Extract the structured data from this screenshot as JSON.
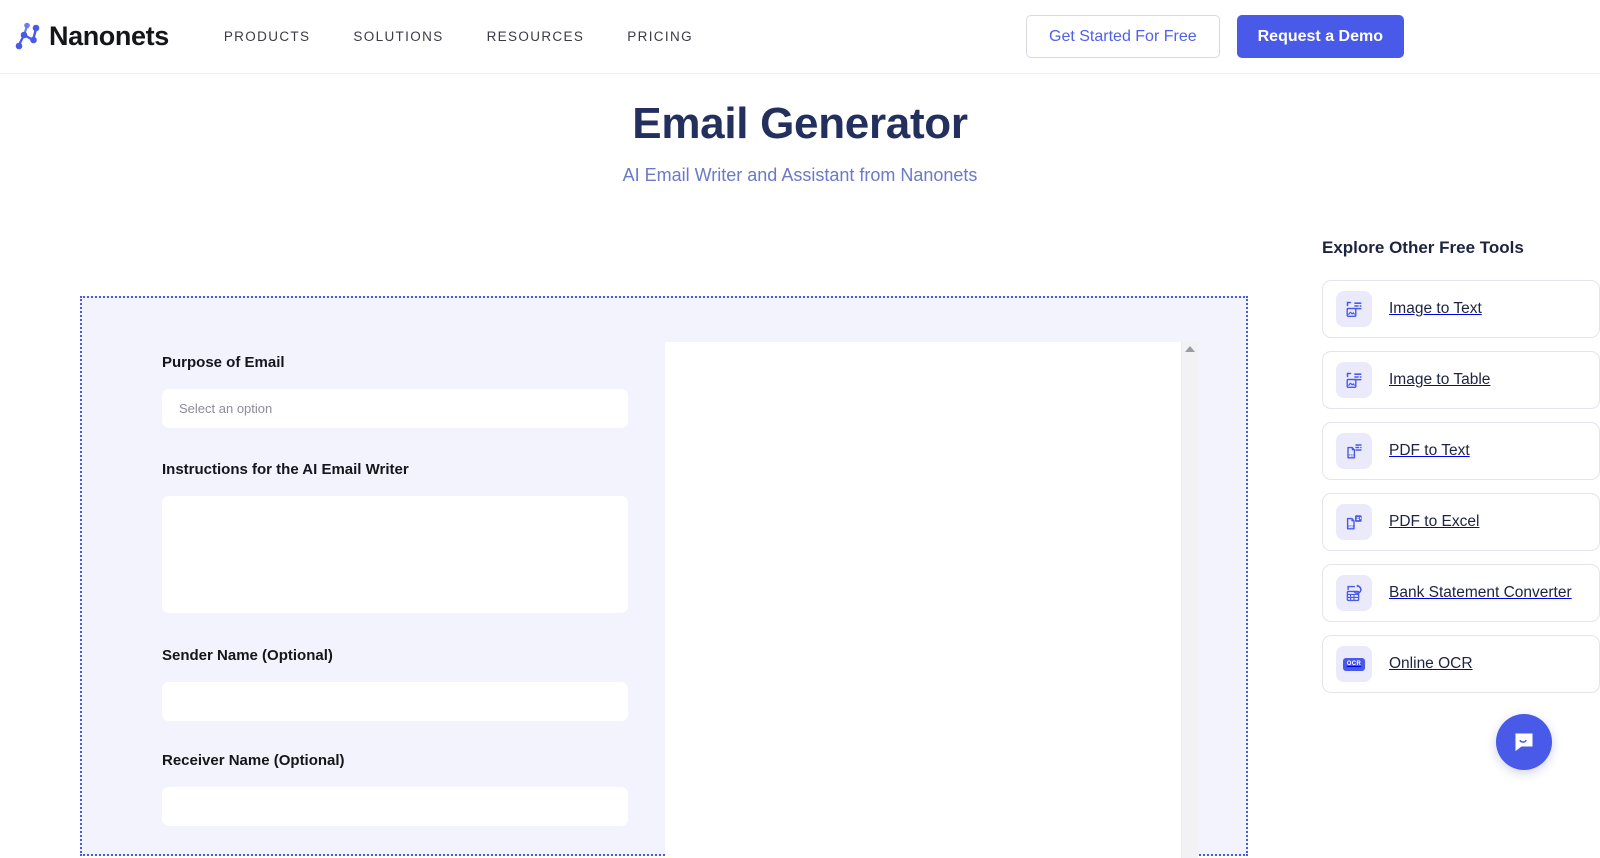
{
  "header": {
    "brand_name": "Nanonets",
    "logo_icon": "nanonets-network-logo",
    "nav": [
      {
        "label": "PRODUCTS"
      },
      {
        "label": "SOLUTIONS"
      },
      {
        "label": "RESOURCES"
      },
      {
        "label": "PRICING"
      }
    ],
    "secondary_cta": "Get Started For Free",
    "primary_cta": "Request a Demo"
  },
  "hero": {
    "title": "Email Generator",
    "subtitle": "AI Email Writer and Assistant from Nanonets"
  },
  "form": {
    "purpose": {
      "label": "Purpose of Email",
      "placeholder": "Select an option",
      "value": ""
    },
    "instructions": {
      "label": "Instructions for the AI Email Writer",
      "placeholder": "",
      "value": ""
    },
    "sender": {
      "label": "Sender Name (Optional)",
      "placeholder": "",
      "value": ""
    },
    "receiver": {
      "label": "Receiver Name (Optional)",
      "placeholder": "",
      "value": ""
    }
  },
  "output": {
    "text": "",
    "scrollbar_up_icon": "triangle-up-icon"
  },
  "sidebar": {
    "heading": "Explore Other Free Tools",
    "tools": [
      {
        "label": "Image to Text",
        "icon": "image-to-text-icon"
      },
      {
        "label": "Image to Table",
        "icon": "image-to-table-icon"
      },
      {
        "label": "PDF to Text",
        "icon": "pdf-to-text-icon"
      },
      {
        "label": "PDF to Excel",
        "icon": "pdf-to-excel-icon"
      },
      {
        "label": "Bank Statement Converter",
        "icon": "bank-statement-icon"
      },
      {
        "label": "Online OCR",
        "icon": "online-ocr-icon",
        "chip_text": "OCR"
      }
    ]
  },
  "chat": {
    "icon": "chat-bubble-icon"
  },
  "colors": {
    "brand_blue": "#4a5ae8",
    "title_navy": "#23305d",
    "subtitle_blue": "#6a79c8",
    "panel_bg": "#f2f3fd",
    "icon_tile_bg": "#eaeafb"
  }
}
